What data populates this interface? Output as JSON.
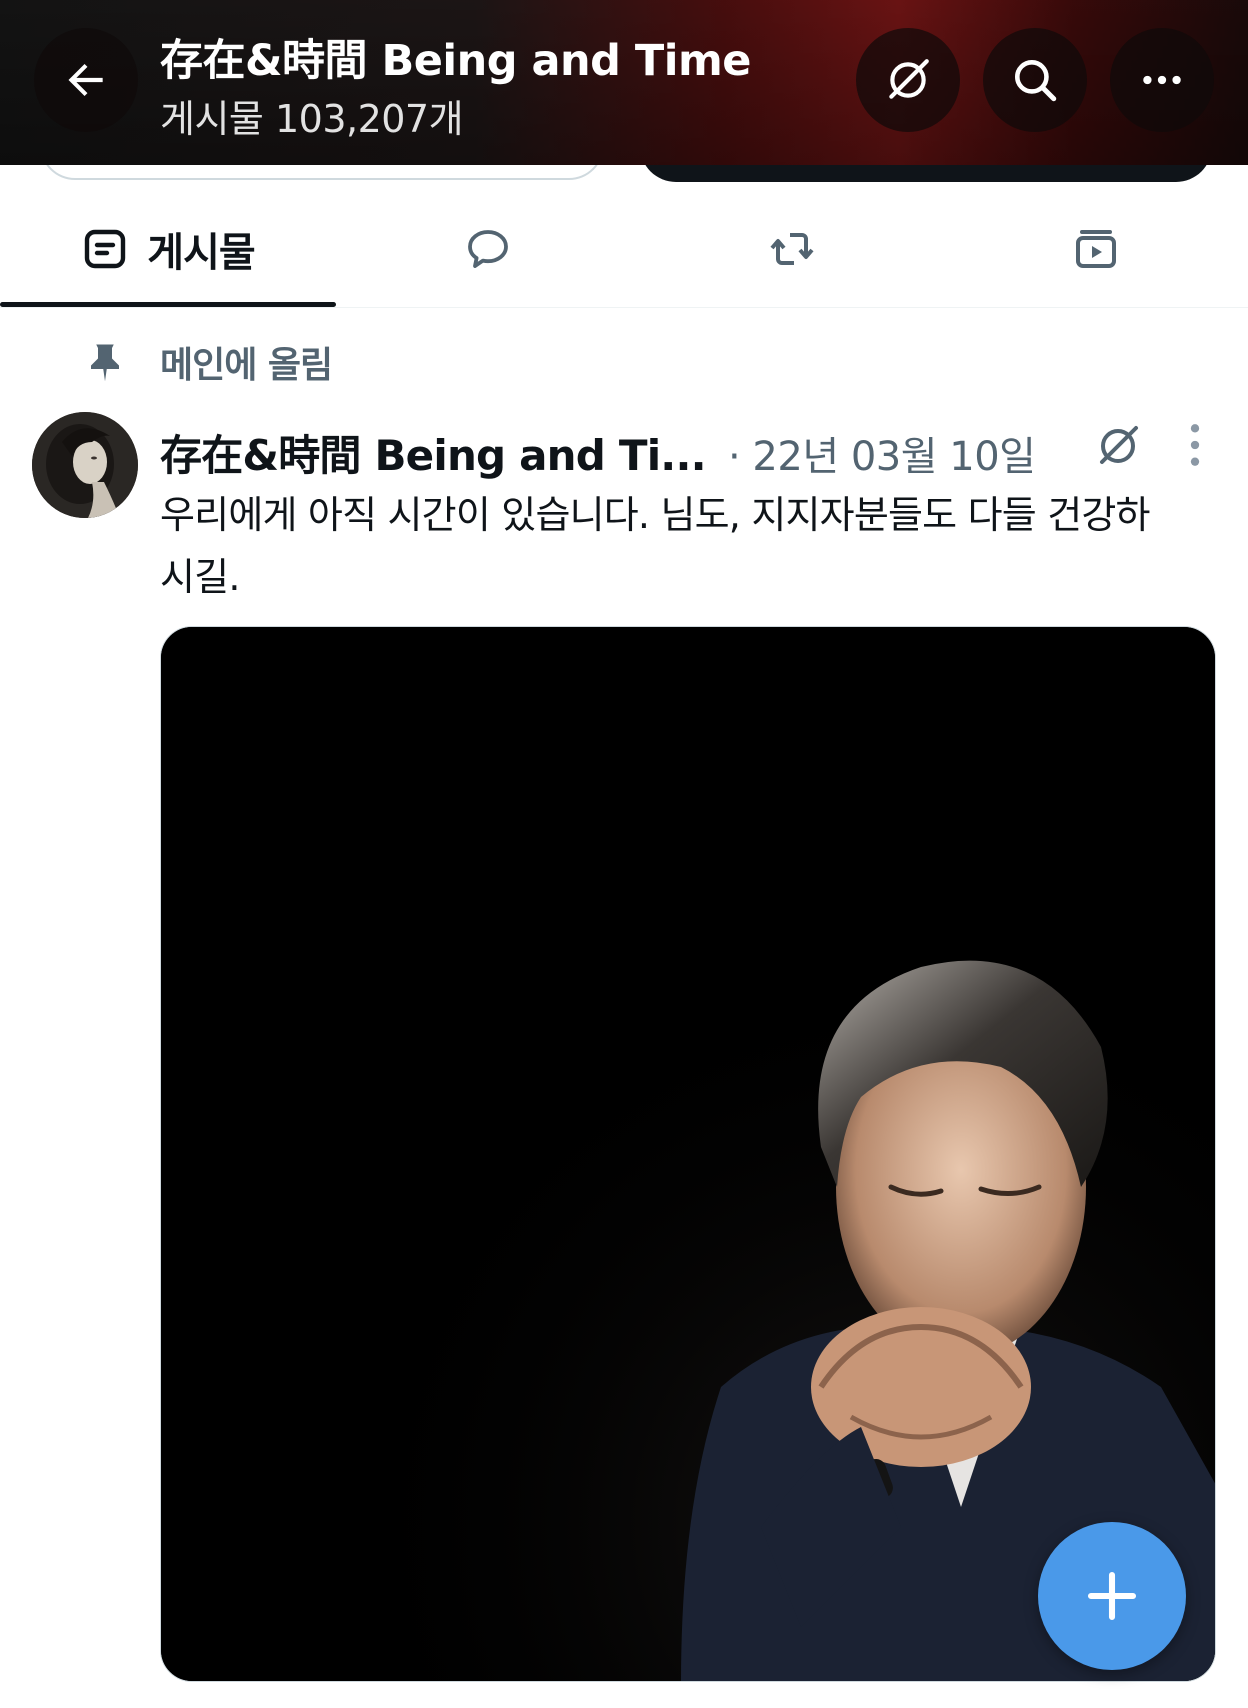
{
  "header": {
    "title": "存在&時間 Being and Time",
    "post_count": "게시물 103,207개",
    "icons": [
      "back-arrow-icon",
      "premium-badge-icon",
      "search-icon",
      "more-icon"
    ]
  },
  "tabs": [
    {
      "label": "게시물",
      "icon": "posts-icon",
      "active": true
    },
    {
      "label": "",
      "icon": "reply-icon",
      "active": false
    },
    {
      "label": "",
      "icon": "repost-icon",
      "active": false
    },
    {
      "label": "",
      "icon": "media-icon",
      "active": false
    }
  ],
  "pinned": {
    "label": "메인에 올림",
    "icon": "pin-icon"
  },
  "post": {
    "author": "存在&時間 Being and Ti...",
    "date": "· 22년 03월 10일",
    "text": "우리에게 아직 시간이 있습니다. 님도, 지지자분들도 다들 건강하시길.",
    "media_description": "photo"
  },
  "colors": {
    "accent": "#4a99e9",
    "text_primary": "#0f1419",
    "text_secondary": "#536471",
    "header_red": "#6e1414"
  }
}
